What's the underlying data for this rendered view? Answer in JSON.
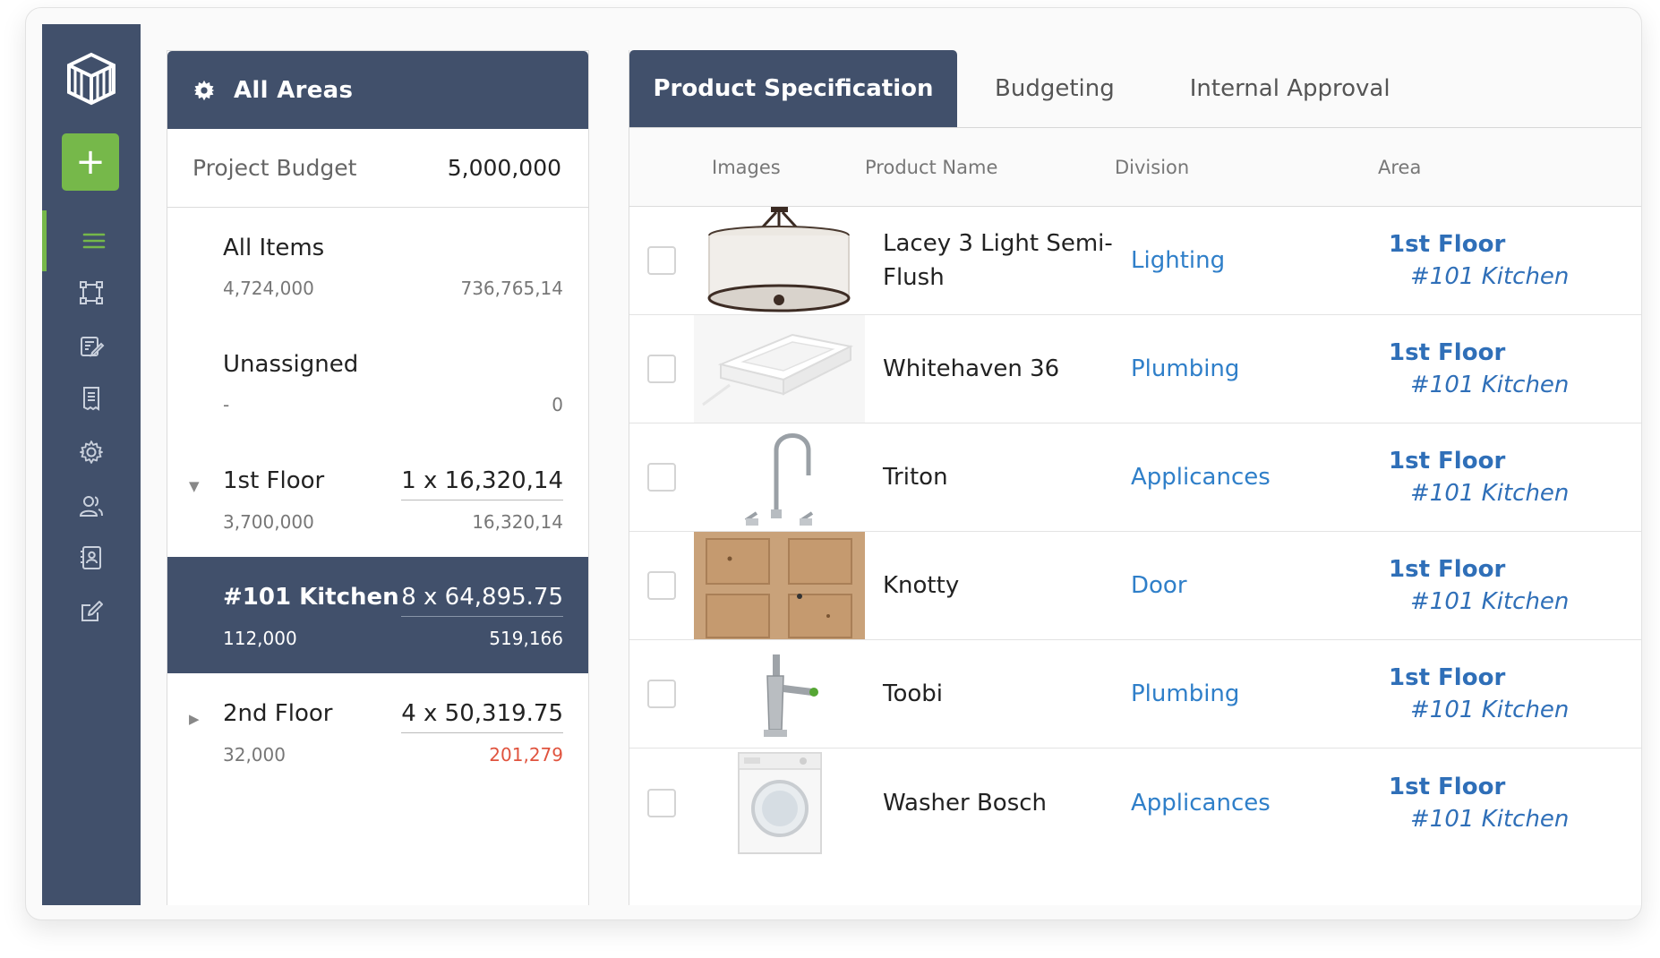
{
  "sidebar": {
    "add_label": "+",
    "items": [
      {
        "icon": "menu-icon",
        "active": true
      },
      {
        "icon": "floorplan-icon",
        "active": false
      },
      {
        "icon": "spec-edit-icon",
        "active": false
      },
      {
        "icon": "receipt-icon",
        "active": false
      },
      {
        "icon": "gear-icon",
        "active": false
      },
      {
        "icon": "users-icon",
        "active": false
      },
      {
        "icon": "contact-card-icon",
        "active": false
      },
      {
        "icon": "edit-icon",
        "active": false
      }
    ]
  },
  "areas": {
    "title": "All Areas",
    "budget_label": "Project Budget",
    "budget_value": "5,000,000",
    "rows": [
      {
        "name": "All Items",
        "left": "4,724,000",
        "right": "736,765,14"
      },
      {
        "name": "Unassigned",
        "left": "-",
        "right": "0"
      },
      {
        "name": "1st Floor",
        "qty": "1 x 16,320,14",
        "left": "3,700,000",
        "right": "16,320,14"
      },
      {
        "name": "#101 Kitchen",
        "qty": "8 x 64,895.75",
        "left": "112,000",
        "right": "519,166"
      },
      {
        "name": "2nd Floor",
        "qty": "4 x 50,319.75",
        "left": "32,000",
        "right": "201,279"
      }
    ]
  },
  "tabs": [
    "Product Specification",
    "Budgeting",
    "Internal Approval"
  ],
  "table": {
    "headers": {
      "images": "Images",
      "name": "Product Name",
      "division": "Division",
      "area": "Area"
    },
    "rows": [
      {
        "name": "Lacey 3 Light Semi-Flush",
        "division": "Lighting",
        "floor": "1st Floor",
        "room": "#101 Kitchen",
        "image": "pendant-light-image"
      },
      {
        "name": "Whitehaven 36",
        "division": "Plumbing",
        "floor": "1st Floor",
        "room": "#101 Kitchen",
        "image": "sink-image"
      },
      {
        "name": "Triton",
        "division": "Applicances",
        "floor": "1st Floor",
        "room": "#101 Kitchen",
        "image": "faucet-image"
      },
      {
        "name": "Knotty",
        "division": "Door",
        "floor": "1st Floor",
        "room": "#101 Kitchen",
        "image": "door-image"
      },
      {
        "name": "Toobi",
        "division": "Plumbing",
        "floor": "1st Floor",
        "room": "#101 Kitchen",
        "image": "tap-image"
      },
      {
        "name": "Washer Bosch",
        "division": "Applicances",
        "floor": "1st Floor",
        "room": "#101 Kitchen",
        "image": "washer-image"
      }
    ]
  },
  "colors": {
    "navy": "#41506b",
    "accent_green": "#76b84a",
    "link_blue": "#2f7fc9",
    "over_budget_red": "#e0533e"
  }
}
